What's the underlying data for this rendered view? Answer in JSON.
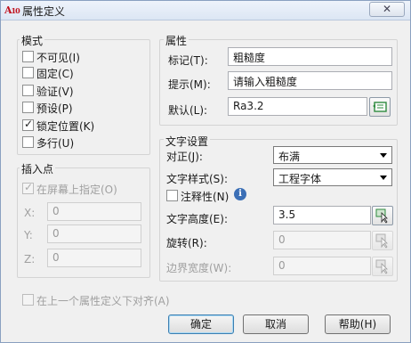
{
  "window": {
    "title": "属性定义",
    "close_label": "✕"
  },
  "mode": {
    "legend": "模式",
    "items": [
      {
        "label": "不可见(I)",
        "checked": false
      },
      {
        "label": "固定(C)",
        "checked": false
      },
      {
        "label": "验证(V)",
        "checked": false
      },
      {
        "label": "预设(P)",
        "checked": false
      },
      {
        "label": "锁定位置(K)",
        "checked": true
      },
      {
        "label": "多行(U)",
        "checked": false
      }
    ]
  },
  "insertion": {
    "legend": "插入点",
    "specify_on_screen": {
      "label": "在屏幕上指定(O)",
      "checked": true
    },
    "x": {
      "label": "X:",
      "value": "0"
    },
    "y": {
      "label": "Y:",
      "value": "0"
    },
    "z": {
      "label": "Z:",
      "value": "0"
    }
  },
  "attribute": {
    "legend": "属性",
    "tag": {
      "label": "标记(T):",
      "value": "粗糙度"
    },
    "prompt": {
      "label": "提示(M):",
      "value": "请输入粗糙度"
    },
    "default": {
      "label": "默认(L):",
      "value": "Ra3.2"
    }
  },
  "text_settings": {
    "legend": "文字设置",
    "justify": {
      "label": "对正(J):",
      "value": "布满"
    },
    "style": {
      "label": "文字样式(S):",
      "value": "工程字体"
    },
    "annotative": {
      "label": "注释性(N)",
      "checked": false
    },
    "height": {
      "label": "文字高度(E):",
      "value": "3.5"
    },
    "rotation": {
      "label": "旋转(R):",
      "value": "0"
    },
    "boundary_width": {
      "label": "边界宽度(W):",
      "value": "0"
    }
  },
  "align_below": {
    "label": "在上一个属性定义下对齐(A)",
    "checked": false
  },
  "buttons": {
    "ok": "确定",
    "cancel": "取消",
    "help": "帮助(H)"
  },
  "colors": {
    "title_bar": "#dce6f4",
    "dialog_bg": "#f0f0f0",
    "accent_red": "#c0101c",
    "field_green": "#2e8a3e"
  }
}
